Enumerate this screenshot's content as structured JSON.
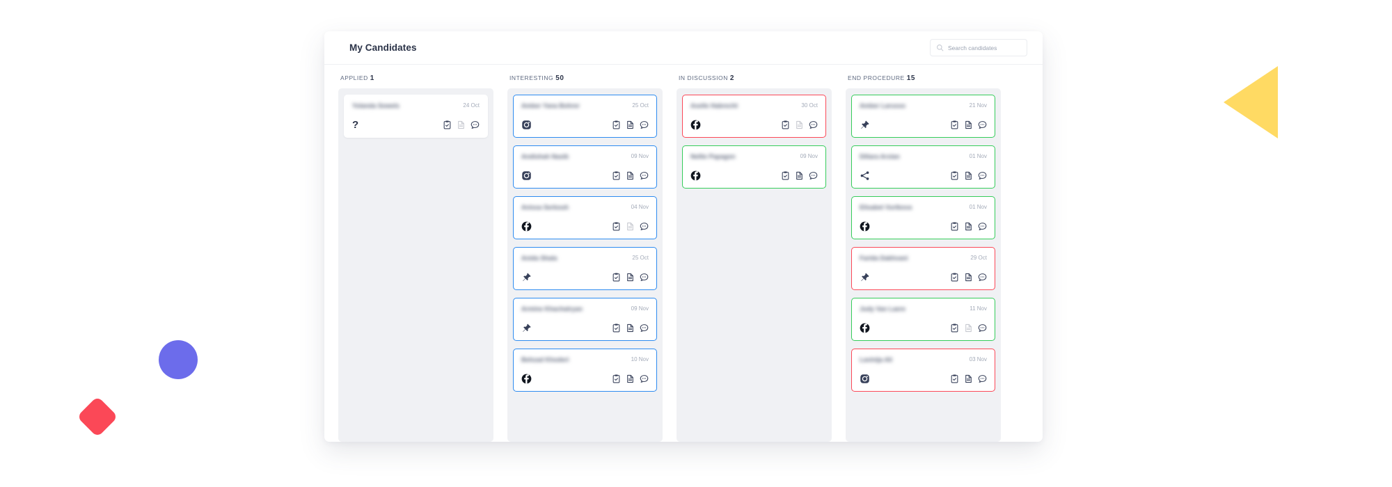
{
  "header": {
    "title": "My Candidates",
    "search_placeholder": "Search candidates",
    "search_value": "",
    "search_icon": "search-icon"
  },
  "theme": {
    "blue": "#2d8bf0",
    "green": "#35cc5a",
    "red": "#fb4857",
    "column_bg": "#f0f1f4",
    "text_dark": "#2b3348",
    "text_muted": "#a3aab8",
    "deco_yellow": "#ffda63",
    "deco_purple": "#6c6ceb",
    "deco_red": "#fb4857"
  },
  "actions_labels": {
    "task": "clipboard-check-icon",
    "document": "document-icon",
    "comment": "comment-icon"
  },
  "columns": [
    {
      "label": "APPLIED",
      "count": "1",
      "cards": [
        {
          "name": "Yolanda Sowels",
          "date": "24 Oct",
          "source": "question",
          "status": "plain",
          "actions": {
            "task": true,
            "document": false,
            "comment": true
          }
        }
      ]
    },
    {
      "label": "INTERESTING",
      "count": "50",
      "cards": [
        {
          "name": "Amber Yana Bohrer",
          "date": "25 Oct",
          "source": "instagram",
          "status": "blue",
          "actions": {
            "task": true,
            "document": true,
            "comment": true
          }
        },
        {
          "name": "Andishah Nasib",
          "date": "09 Nov",
          "source": "instagram",
          "status": "blue",
          "actions": {
            "task": true,
            "document": true,
            "comment": true
          }
        },
        {
          "name": "Anissa Serkouh",
          "date": "04 Nov",
          "source": "facebook",
          "status": "blue",
          "actions": {
            "task": true,
            "document": false,
            "comment": true
          }
        },
        {
          "name": "Anida Shala",
          "date": "25 Oct",
          "source": "pin",
          "status": "blue",
          "actions": {
            "task": true,
            "document": true,
            "comment": true
          }
        },
        {
          "name": "Armine Khachatryan",
          "date": "09 Nov",
          "source": "pin",
          "status": "blue",
          "actions": {
            "task": true,
            "document": true,
            "comment": true
          }
        },
        {
          "name": "Behzad Khoderi",
          "date": "10 Nov",
          "source": "facebook",
          "status": "blue",
          "actions": {
            "task": true,
            "document": true,
            "comment": true
          }
        }
      ]
    },
    {
      "label": "IN DISCUSSION",
      "count": "2",
      "cards": [
        {
          "name": "Axelle Habrecht",
          "date": "30 Oct",
          "source": "facebook",
          "status": "red",
          "actions": {
            "task": true,
            "document": false,
            "comment": true
          }
        },
        {
          "name": "Nellie Papagon",
          "date": "09 Nov",
          "source": "facebook",
          "status": "green",
          "actions": {
            "task": true,
            "document": true,
            "comment": true
          }
        }
      ]
    },
    {
      "label": "END PROCEDURE",
      "count": "15",
      "cards": [
        {
          "name": "Amber Larusso",
          "date": "21 Nov",
          "source": "pin",
          "status": "green",
          "actions": {
            "task": true,
            "document": true,
            "comment": true
          }
        },
        {
          "name": "Diliara Arslan",
          "date": "01 Nov",
          "source": "share",
          "status": "green",
          "actions": {
            "task": true,
            "document": true,
            "comment": true
          }
        },
        {
          "name": "Elisabet Vurtkova",
          "date": "01 Nov",
          "source": "facebook",
          "status": "green",
          "actions": {
            "task": true,
            "document": true,
            "comment": true
          }
        },
        {
          "name": "Farida Dakhvani",
          "date": "29 Oct",
          "source": "pin",
          "status": "red",
          "actions": {
            "task": true,
            "document": true,
            "comment": true
          }
        },
        {
          "name": "Judy Van Laere",
          "date": "11 Nov",
          "source": "facebook",
          "status": "green",
          "actions": {
            "task": true,
            "document": false,
            "comment": true
          }
        },
        {
          "name": "Lavinija Ali",
          "date": "03 Nov",
          "source": "instagram",
          "status": "red",
          "actions": {
            "task": true,
            "document": true,
            "comment": true
          }
        }
      ]
    }
  ],
  "decorations": [
    {
      "name": "triangle-shape",
      "color": "#ffda63"
    },
    {
      "name": "circle-shape",
      "color": "#6c6ceb"
    },
    {
      "name": "diamond-shape",
      "color": "#fb4857"
    }
  ]
}
